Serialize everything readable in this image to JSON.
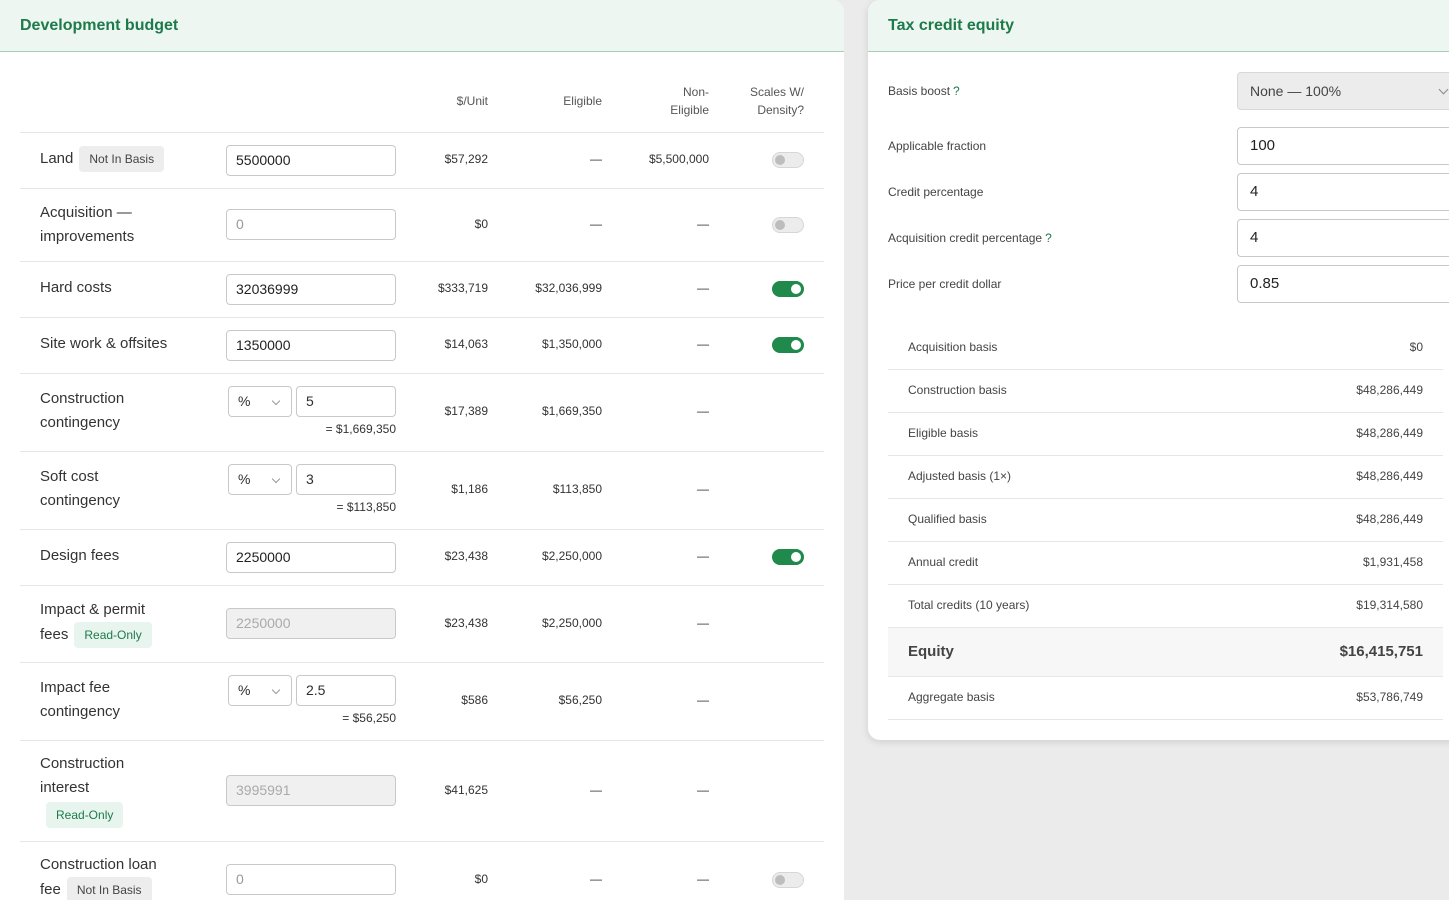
{
  "left_panel": {
    "title": "Development budget",
    "columns": {
      "unit": "$/Unit",
      "eligible": "Eligible",
      "non_eligible_1": "Non-",
      "non_eligible_2": "Eligible",
      "scales_1": "Scales W/",
      "scales_2": "Density?"
    },
    "rows": {
      "land": {
        "label": "Land",
        "badge": "Not In Basis",
        "value": "5500000",
        "unit": "$57,292",
        "eligible": "—",
        "non_eligible": "$5,500,000",
        "toggle": "off"
      },
      "acq": {
        "label_1": "Acquisition —",
        "label_2": "improvements",
        "placeholder": "0",
        "unit": "$0",
        "eligible": "—",
        "non_eligible": "—",
        "toggle": "off"
      },
      "hard": {
        "label": "Hard costs",
        "value": "32036999",
        "unit": "$333,719",
        "eligible": "$32,036,999",
        "non_eligible": "—",
        "toggle": "on"
      },
      "site": {
        "label": "Site work & offsites",
        "value": "1350000",
        "unit": "$14,063",
        "eligible": "$1,350,000",
        "non_eligible": "—",
        "toggle": "on"
      },
      "cc": {
        "label_1": "Construction",
        "label_2": "contingency",
        "mode": "%",
        "value": "5",
        "computed": "= $1,669,350",
        "unit": "$17,389",
        "eligible": "$1,669,350",
        "non_eligible": "—"
      },
      "scc": {
        "label_1": "Soft cost",
        "label_2": "contingency",
        "mode": "%",
        "value": "3",
        "computed": "= $113,850",
        "unit": "$1,186",
        "eligible": "$113,850",
        "non_eligible": "—"
      },
      "design": {
        "label": "Design fees",
        "value": "2250000",
        "unit": "$23,438",
        "eligible": "$2,250,000",
        "non_eligible": "—",
        "toggle": "on"
      },
      "impact": {
        "label_1": "Impact & permit",
        "label_2": "fees",
        "badge": "Read-Only",
        "value": "2250000",
        "unit": "$23,438",
        "eligible": "$2,250,000",
        "non_eligible": "—"
      },
      "ifc": {
        "label_1": "Impact fee",
        "label_2": "contingency",
        "mode": "%",
        "value": "2.5",
        "computed": "= $56,250",
        "unit": "$586",
        "eligible": "$56,250",
        "non_eligible": "—"
      },
      "ci": {
        "label_1": "Construction",
        "label_2": "interest",
        "badge": "Read-Only",
        "value": "3995991",
        "unit": "$41,625",
        "eligible": "—",
        "non_eligible": "—"
      },
      "clf": {
        "label_1": "Construction loan",
        "label_2": "fee",
        "badge": "Not In Basis",
        "placeholder": "0",
        "unit": "$0",
        "eligible": "—",
        "non_eligible": "—",
        "toggle": "off"
      }
    }
  },
  "right_panel": {
    "title": "Tax credit equity",
    "basis_boost": {
      "label": "Basis boost",
      "help": "?",
      "value": "None — 100%"
    },
    "applicable_fraction": {
      "label": "Applicable fraction",
      "value": "100"
    },
    "credit_percentage": {
      "label": "Credit percentage",
      "value": "4"
    },
    "acq_credit_percentage": {
      "label": "Acquisition credit percentage",
      "help": "?",
      "value": "4"
    },
    "price_per_credit": {
      "label": "Price per credit dollar",
      "value": "0.85"
    },
    "summary": {
      "acquisition_basis": {
        "label": "Acquisition basis",
        "value": "$0"
      },
      "construction_basis": {
        "label": "Construction basis",
        "value": "$48,286,449"
      },
      "eligible_basis": {
        "label": "Eligible basis",
        "value": "$48,286,449"
      },
      "adjusted_basis": {
        "label": "Adjusted basis (1×)",
        "value": "$48,286,449"
      },
      "qualified_basis": {
        "label": "Qualified basis",
        "value": "$48,286,449"
      },
      "annual_credit": {
        "label": "Annual credit",
        "value": "$1,931,458"
      },
      "total_credits": {
        "label": "Total credits (10 years)",
        "value": "$19,314,580"
      },
      "equity": {
        "label": "Equity",
        "value": "$16,415,751"
      },
      "aggregate_basis": {
        "label": "Aggregate basis",
        "value": "$53,786,749"
      }
    }
  },
  "colors": {
    "accent": "#1d7a4a",
    "toggle_on": "#1f8a4c",
    "header_bg": "#eef6f1"
  }
}
